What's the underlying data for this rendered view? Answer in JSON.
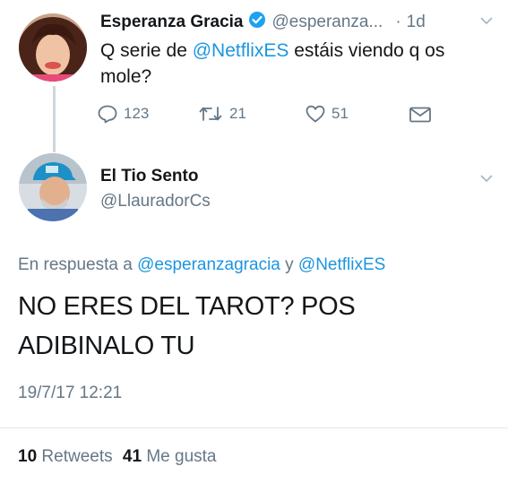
{
  "tweet1": {
    "author_name": "Esperanza Gracia",
    "handle": "@esperanza...",
    "separator": "·",
    "time": "1d",
    "text_q": "Q serie de ",
    "mention": "@NetflixES",
    "text_rest": " estáis viendo q os mole?",
    "replies": "123",
    "retweets": "21",
    "likes": "51"
  },
  "tweet2": {
    "author_name": "El Tio Sento",
    "handle": "@LlauradorCs",
    "reply_prefix": "En respuesta a ",
    "reply_user1": "@esperanzagracia",
    "reply_and": " y ",
    "reply_user2": "@NetflixES",
    "text_line1": "NO ERES DEL TAROT? POS",
    "text_line2": "ADIBINALO TU",
    "date": "19/7/17 12:21",
    "retweet_count": "10",
    "retweet_label": "Retweets",
    "like_count": "41",
    "like_label": "Me gusta"
  },
  "colors": {
    "link": "#1b95e0",
    "muted": "#657786",
    "verified": "#1da1f2",
    "divider": "#e1e8ed"
  },
  "icons": [
    "verified-badge-icon",
    "chevron-down-icon",
    "reply-icon",
    "retweet-icon",
    "like-icon",
    "direct-message-icon"
  ]
}
